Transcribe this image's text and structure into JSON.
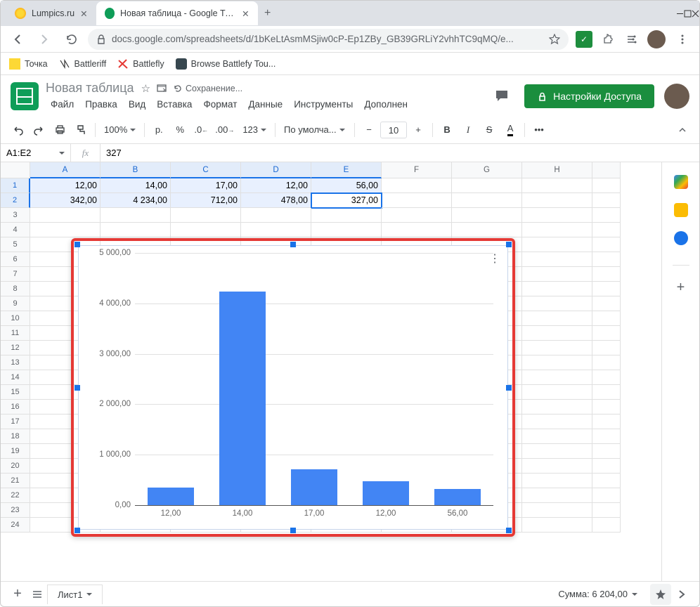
{
  "window": {
    "tabs": [
      {
        "title": "Lumpics.ru",
        "icon_color": "#f9a825"
      },
      {
        "title": "Новая таблица - Google Таблиц",
        "icon_color": "#0f9d58"
      }
    ]
  },
  "browser": {
    "url": "docs.google.com/spreadsheets/d/1bKeLtAsmMSjiw0cP-Ep1ZBy_GB39GRLiY2vhhTC9qMQ/e..."
  },
  "bookmarks": [
    {
      "label": "Точка"
    },
    {
      "label": "Battleriff"
    },
    {
      "label": "Battlefly"
    },
    {
      "label": "Browse Battlefy Tou..."
    }
  ],
  "sheets": {
    "doc_title": "Новая таблица",
    "saving": "Сохранение...",
    "menus": [
      "Файл",
      "Правка",
      "Вид",
      "Вставка",
      "Формат",
      "Данные",
      "Инструменты",
      "Дополнен"
    ],
    "share_label": "Настройки Доступа"
  },
  "toolbar": {
    "zoom": "100%",
    "currency": "р.",
    "formats": "123",
    "font": "По умолча...",
    "fontsize": "10"
  },
  "fx": {
    "namebox": "A1:E2",
    "value": "327"
  },
  "columns": [
    "A",
    "B",
    "C",
    "D",
    "E",
    "F",
    "G",
    "H"
  ],
  "rows": [
    {
      "n": "1",
      "cells": [
        "12,00",
        "14,00",
        "17,00",
        "12,00",
        "56,00",
        "",
        "",
        ""
      ]
    },
    {
      "n": "2",
      "cells": [
        "342,00",
        "4 234,00",
        "712,00",
        "478,00",
        "327,00",
        "",
        "",
        ""
      ]
    }
  ],
  "empty_rows": [
    "3",
    "4",
    "5",
    "6",
    "7",
    "8",
    "9",
    "10",
    "11",
    "12",
    "13",
    "14",
    "15",
    "16",
    "17",
    "18",
    "19",
    "20",
    "21",
    "22",
    "23",
    "24"
  ],
  "chart_data": {
    "type": "bar",
    "categories": [
      "12,00",
      "14,00",
      "17,00",
      "12,00",
      "56,00"
    ],
    "values": [
      342,
      4234,
      712,
      478,
      327
    ],
    "ylabels": [
      "0,00",
      "1 000,00",
      "2 000,00",
      "3 000,00",
      "4 000,00",
      "5 000,00"
    ],
    "ylim": [
      0,
      5000
    ],
    "title": "",
    "xlabel": "",
    "ylabel": ""
  },
  "sheetbar": {
    "tab": "Лист1",
    "sum_label": "Сумма: 6 204,00"
  }
}
